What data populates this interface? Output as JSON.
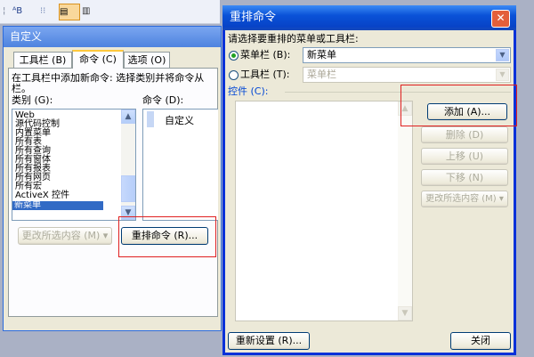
{
  "toolbar": {
    "icon2": "ᴬB",
    "icon3": "⁝⁝",
    "icon4": "▤",
    "icon5": "▥"
  },
  "customize": {
    "title": "自定义",
    "tabs": [
      "工具栏 (B)",
      "命令 (C)",
      "选项 (O)"
    ],
    "instruction": "在工具栏中添加新命令: 选择类别并将命令从",
    "instruction_cont": "栏。",
    "category_label": "类别 (G):",
    "command_label": "命令 (D):",
    "categories": [
      "Web",
      "源代码控制",
      "内置菜单",
      "所有表",
      "所有查询",
      "所有窗体",
      "所有报表",
      "所有网页",
      "所有宏",
      "ActiveX 控件",
      "新菜单"
    ],
    "selected_category": "新菜单",
    "commands": [
      "自定义"
    ],
    "modify_selection": "更改所选内容 (M) ▾",
    "rearrange_button": "重排命令 (R)..."
  },
  "reorder": {
    "title": "重排命令",
    "prompt": "请选择要重排的菜单或工具栏:",
    "menubar_label": "菜单栏 (B):",
    "menubar_value": "新菜单",
    "toolbar_label": "工具栏 (T):",
    "toolbar_value": "菜单栏",
    "controls_label": "控件 (C):",
    "buttons": {
      "add": "添加 (A)...",
      "delete": "删除 (D)",
      "move_up": "上移 (U)",
      "move_down": "下移 (N)",
      "modify": "更改所选内容 (M) ▾",
      "reset": "重新设置 (R)...",
      "close": "关闭"
    }
  },
  "colors": {
    "title_bar": "#0a52d8",
    "dialog_bg": "#ece9d8",
    "selection": "#316ac5",
    "highlight_box": "#e02020"
  }
}
